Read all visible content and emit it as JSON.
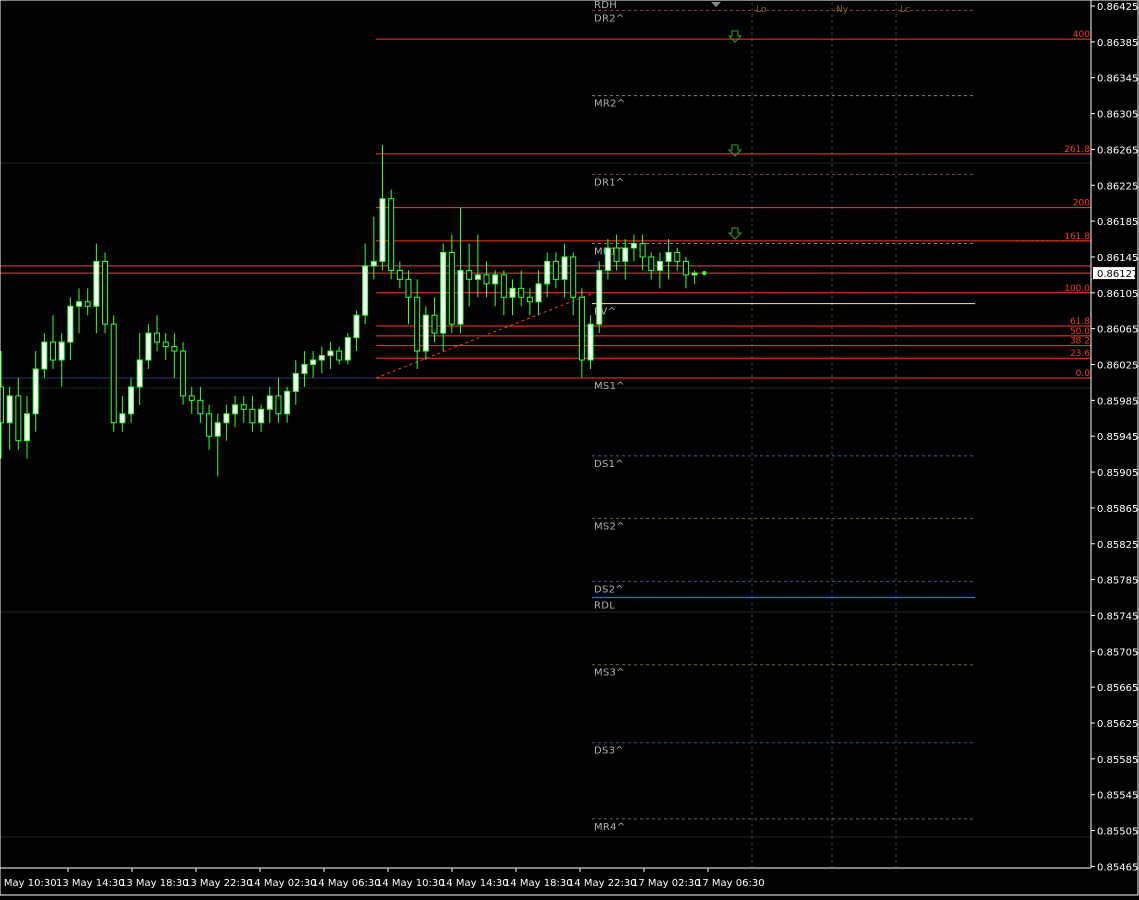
{
  "chart_data": {
    "type": "candlestick",
    "price_axis": {
      "ylim": [
        0.85455,
        0.86435
      ],
      "ticks": [
        "0.86425",
        "0.86385",
        "0.86345",
        "0.86305",
        "0.86265",
        "0.86225",
        "0.86185",
        "0.86145",
        "0.86105",
        "0.86065",
        "0.86025",
        "0.85985",
        "0.85945",
        "0.85905",
        "0.85865",
        "0.85825",
        "0.85785",
        "0.85745",
        "0.85705",
        "0.85665",
        "0.85625",
        "0.85585",
        "0.85545",
        "0.85505",
        "0.85465"
      ],
      "current_price": "0.86127"
    },
    "time_axis": {
      "ticks": [
        "13 May 10:30",
        "13 May 14:30",
        "13 May 18:30",
        "13 May 22:30",
        "14 May 02:30",
        "14 May 06:30",
        "14 May 10:30",
        "14 May 14:30",
        "14 May 18:30",
        "14 May 22:30",
        "17 May 02:30",
        "17 May 06:30"
      ]
    },
    "candles": [
      [
        0.86,
        0.8604,
        0.8592,
        0.8596
      ],
      [
        0.8596,
        0.86,
        0.8593,
        0.8599
      ],
      [
        0.8599,
        0.8601,
        0.8593,
        0.8594
      ],
      [
        0.8594,
        0.8599,
        0.8592,
        0.8597
      ],
      [
        0.8597,
        0.8604,
        0.8595,
        0.8602
      ],
      [
        0.8602,
        0.8606,
        0.8601,
        0.8605
      ],
      [
        0.8605,
        0.8608,
        0.8602,
        0.8603
      ],
      [
        0.8603,
        0.8606,
        0.86,
        0.8605
      ],
      [
        0.8605,
        0.861,
        0.8603,
        0.8609
      ],
      [
        0.8609,
        0.8611,
        0.8606,
        0.86095
      ],
      [
        0.86095,
        0.8611,
        0.8608,
        0.8609
      ],
      [
        0.8609,
        0.8616,
        0.8606,
        0.8614
      ],
      [
        0.8614,
        0.8615,
        0.8606,
        0.8607
      ],
      [
        0.8607,
        0.8608,
        0.8595,
        0.8596
      ],
      [
        0.8596,
        0.8599,
        0.8595,
        0.8597
      ],
      [
        0.8597,
        0.8601,
        0.8596,
        0.86
      ],
      [
        0.86,
        0.8606,
        0.8598,
        0.8603
      ],
      [
        0.8603,
        0.8607,
        0.8602,
        0.8606
      ],
      [
        0.8606,
        0.8608,
        0.8604,
        0.8605
      ],
      [
        0.8605,
        0.8606,
        0.8603,
        0.86045
      ],
      [
        0.86045,
        0.8606,
        0.8601,
        0.8604
      ],
      [
        0.8604,
        0.8605,
        0.8598,
        0.8599
      ],
      [
        0.8599,
        0.86,
        0.8597,
        0.85985
      ],
      [
        0.85985,
        0.86,
        0.8596,
        0.8597
      ],
      [
        0.8597,
        0.8598,
        0.8593,
        0.85945
      ],
      [
        0.85945,
        0.8597,
        0.859,
        0.8596
      ],
      [
        0.8596,
        0.8598,
        0.8594,
        0.8597
      ],
      [
        0.8597,
        0.8599,
        0.85955,
        0.8598
      ],
      [
        0.8598,
        0.8599,
        0.8596,
        0.85975
      ],
      [
        0.85975,
        0.8599,
        0.8595,
        0.8596
      ],
      [
        0.8596,
        0.8598,
        0.8595,
        0.85975
      ],
      [
        0.85975,
        0.86,
        0.8596,
        0.8599
      ],
      [
        0.8599,
        0.8601,
        0.8596,
        0.8597
      ],
      [
        0.8597,
        0.86,
        0.8596,
        0.85995
      ],
      [
        0.85995,
        0.8603,
        0.8598,
        0.86015
      ],
      [
        0.86015,
        0.8604,
        0.86,
        0.86025
      ],
      [
        0.86025,
        0.8604,
        0.8601,
        0.8603
      ],
      [
        0.8603,
        0.86045,
        0.86015,
        0.86035
      ],
      [
        0.86035,
        0.8605,
        0.8602,
        0.8604
      ],
      [
        0.8604,
        0.86045,
        0.86025,
        0.8603
      ],
      [
        0.8603,
        0.8606,
        0.86025,
        0.86055
      ],
      [
        0.86055,
        0.86085,
        0.8604,
        0.8608
      ],
      [
        0.8608,
        0.8616,
        0.8607,
        0.86135
      ],
      [
        0.86135,
        0.8619,
        0.8612,
        0.8614
      ],
      [
        0.8614,
        0.8627,
        0.8613,
        0.8621
      ],
      [
        0.8621,
        0.8622,
        0.8612,
        0.8613
      ],
      [
        0.8613,
        0.8614,
        0.8611,
        0.8612
      ],
      [
        0.8612,
        0.8613,
        0.8607,
        0.861
      ],
      [
        0.861,
        0.8612,
        0.8602,
        0.8604
      ],
      [
        0.8604,
        0.8609,
        0.8603,
        0.8608
      ],
      [
        0.8608,
        0.861,
        0.8605,
        0.8606
      ],
      [
        0.8606,
        0.8616,
        0.8604,
        0.8615
      ],
      [
        0.8615,
        0.8617,
        0.8606,
        0.8607
      ],
      [
        0.8607,
        0.862,
        0.8606,
        0.8613
      ],
      [
        0.8613,
        0.8616,
        0.8609,
        0.8612
      ],
      [
        0.8612,
        0.8617,
        0.861,
        0.86125
      ],
      [
        0.86125,
        0.8614,
        0.861,
        0.86115
      ],
      [
        0.86115,
        0.8613,
        0.8609,
        0.86125
      ],
      [
        0.86125,
        0.8613,
        0.8608,
        0.861
      ],
      [
        0.861,
        0.8612,
        0.8608,
        0.8611
      ],
      [
        0.8611,
        0.8613,
        0.8609,
        0.861
      ],
      [
        0.861,
        0.8611,
        0.8608,
        0.86095
      ],
      [
        0.86095,
        0.8613,
        0.8608,
        0.86115
      ],
      [
        0.86115,
        0.8615,
        0.861,
        0.8614
      ],
      [
        0.8614,
        0.8615,
        0.8611,
        0.8612
      ],
      [
        0.8612,
        0.8616,
        0.861,
        0.86145
      ],
      [
        0.86145,
        0.8615,
        0.8608,
        0.861
      ],
      [
        0.861,
        0.8611,
        0.8601,
        0.8603
      ],
      [
        0.8603,
        0.8608,
        0.8602,
        0.8607
      ],
      [
        0.8607,
        0.8614,
        0.8606,
        0.8613
      ],
      [
        0.8613,
        0.86165,
        0.8612,
        0.86155
      ],
      [
        0.86155,
        0.8617,
        0.8613,
        0.8614
      ],
      [
        0.8614,
        0.86165,
        0.8612,
        0.86155
      ],
      [
        0.86155,
        0.8617,
        0.8614,
        0.8616
      ],
      [
        0.8616,
        0.8617,
        0.8613,
        0.86145
      ],
      [
        0.86145,
        0.8615,
        0.8612,
        0.8613
      ],
      [
        0.8613,
        0.8615,
        0.8611,
        0.8614
      ],
      [
        0.8614,
        0.86165,
        0.8612,
        0.8615
      ],
      [
        0.8615,
        0.86155,
        0.8613,
        0.8614
      ],
      [
        0.8614,
        0.86145,
        0.8611,
        0.86125
      ],
      [
        0.86125,
        0.8613,
        0.86115,
        0.86127
      ]
    ],
    "horizontal_levels": [
      {
        "label": "RDH",
        "price": 0.86435,
        "color": "#d84a4a",
        "style": "solid"
      },
      {
        "label": "DR2^",
        "price": 0.8642,
        "color": "#8a3a3a",
        "style": "dashed"
      },
      {
        "label": "MR2^",
        "price": 0.86325,
        "color": "#8a8a3a",
        "style": "dashed"
      },
      {
        "label": "DR1^",
        "price": 0.86237,
        "color": "#8a3a3a",
        "style": "dashed"
      },
      {
        "label": "MR1^",
        "price": 0.8616,
        "color": "#8a8a3a",
        "style": "dashed"
      },
      {
        "label": "PV^",
        "price": 0.86093,
        "color": "#d9d64a",
        "style": "solid"
      },
      {
        "label": "MS1^",
        "price": 0.8601,
        "color": "#3a5a9a",
        "style": "dashed"
      },
      {
        "label": "DS1^",
        "price": 0.85923,
        "color": "#3a5a9a",
        "style": "dashed"
      },
      {
        "label": "MS2^",
        "price": 0.85853,
        "color": "#6a6a3a",
        "style": "dashed"
      },
      {
        "label": "DS2^",
        "price": 0.85783,
        "color": "#3a5a9a",
        "style": "dashed"
      },
      {
        "label": "RDL",
        "price": 0.85765,
        "color": "#2f6fd0",
        "style": "solid"
      },
      {
        "label": "MS3^",
        "price": 0.8569,
        "color": "#6a6a3a",
        "style": "dashed"
      },
      {
        "label": "DS3^",
        "price": 0.85603,
        "color": "#3a5a9a",
        "style": "dashed"
      },
      {
        "label": "MR4^",
        "price": 0.85518,
        "color": "#6a6a3a",
        "style": "dashed"
      }
    ],
    "fibonacci_levels": [
      {
        "label": "400",
        "price": 0.86388
      },
      {
        "label": "261.8",
        "price": 0.8626
      },
      {
        "label": "200",
        "price": 0.862
      },
      {
        "label": "161.8",
        "price": 0.86163
      },
      {
        "label": "100.0",
        "price": 0.86105
      },
      {
        "label": "61.8",
        "price": 0.86068
      },
      {
        "label": "50.0",
        "price": 0.86057
      },
      {
        "label": "38.2",
        "price": 0.86046
      },
      {
        "label": "23.6",
        "price": 0.86032
      },
      {
        "label": "0.0",
        "price": 0.8601
      }
    ],
    "session_labels": [
      "Lo",
      "Ny",
      "Lc"
    ]
  },
  "colors": {
    "background": "#000000",
    "candle": "#33ff33",
    "bull_body": "#ffffff",
    "bear_body": "#000000",
    "fib": "#ff3b1f",
    "axis": "#ffffff",
    "current_price_box": "#ffffff"
  }
}
